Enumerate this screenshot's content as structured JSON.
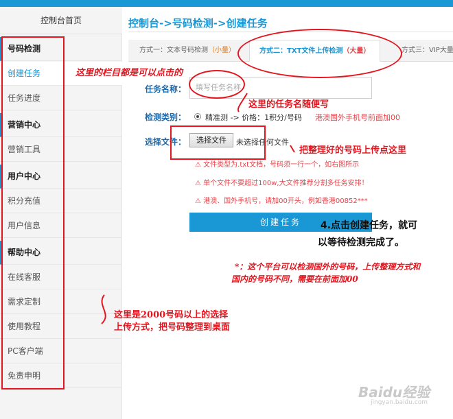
{
  "sidebar": {
    "home": "控制台首页",
    "items": [
      {
        "label": "号码检测",
        "group": true
      },
      {
        "label": "创建任务",
        "active": true
      },
      {
        "label": "任务进度"
      },
      {
        "label": "营销中心",
        "group": true
      },
      {
        "label": "营销工具"
      },
      {
        "label": "用户中心",
        "group": true
      },
      {
        "label": "积分充值"
      },
      {
        "label": "用户信息"
      },
      {
        "label": "帮助中心",
        "group": true
      },
      {
        "label": "在线客服"
      },
      {
        "label": "需求定制"
      },
      {
        "label": "使用教程"
      },
      {
        "label": "PC客户端"
      },
      {
        "label": "免责申明"
      }
    ]
  },
  "breadcrumb": "控制台->号码检测->创建任务",
  "tabs": [
    {
      "label": "方式一：文本号码检测",
      "tag": "（小量）"
    },
    {
      "label": "方式二：TXT文件上传检测",
      "tag": "（大量）"
    },
    {
      "label": "方式三：VIP大量",
      "tag": ""
    }
  ],
  "form": {
    "task_name_label": "任务名称：",
    "task_name_placeholder": "填写任务名称",
    "category_label": "检测类别：",
    "category_option": "精准测 -> 价格：1积分/号码",
    "category_note": "港澳国外手机号前面加00",
    "file_label": "选择文件：",
    "file_button": "选择文件",
    "file_status": "未选择任何文件",
    "warnings": [
      "⚠ 文件类型为.txt文档，号码须一行一个，如右图所示",
      "⚠ 单个文件不要超过100w,大文件推荐分割多任务安排！",
      "⚠ 港澳、国外手机号，请加00开头，例如香港00852***"
    ],
    "submit": "创建任务"
  },
  "annotations": {
    "sidebar_note": "这里的栏目都是可以点击的",
    "name_note": "这里的任务名随便写",
    "upload_note": "把整理好的号码上传点这里",
    "submit_note_1": "4.点击创建任务，就可",
    "submit_note_2": "以等待检测完成了。",
    "foreign_note_1": "*：这个平台可以检测国外的号码，上传整理方式和",
    "foreign_note_2": "国内的号码不同，需要在前面加00",
    "method_note_1": "这里是2000号码以上的选择",
    "method_note_2": "上传方式，把号码整理到桌面"
  },
  "watermark": "Baidu经验",
  "watermark_sub": "jingyan.baidu.com"
}
